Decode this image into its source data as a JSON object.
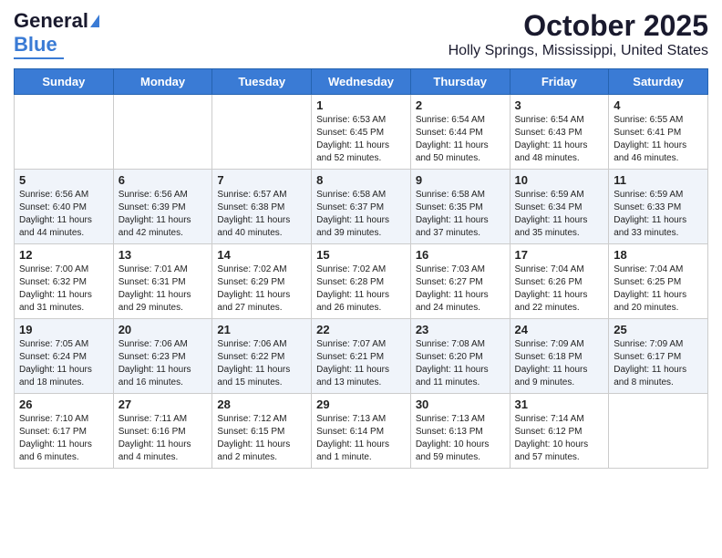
{
  "header": {
    "logo_general": "General",
    "logo_blue": "Blue",
    "title": "October 2025",
    "subtitle": "Holly Springs, Mississippi, United States"
  },
  "days_of_week": [
    "Sunday",
    "Monday",
    "Tuesday",
    "Wednesday",
    "Thursday",
    "Friday",
    "Saturday"
  ],
  "weeks": [
    [
      {
        "day": "",
        "sunrise": "",
        "sunset": "",
        "daylight": ""
      },
      {
        "day": "",
        "sunrise": "",
        "sunset": "",
        "daylight": ""
      },
      {
        "day": "",
        "sunrise": "",
        "sunset": "",
        "daylight": ""
      },
      {
        "day": "1",
        "sunrise": "Sunrise: 6:53 AM",
        "sunset": "Sunset: 6:45 PM",
        "daylight": "Daylight: 11 hours and 52 minutes."
      },
      {
        "day": "2",
        "sunrise": "Sunrise: 6:54 AM",
        "sunset": "Sunset: 6:44 PM",
        "daylight": "Daylight: 11 hours and 50 minutes."
      },
      {
        "day": "3",
        "sunrise": "Sunrise: 6:54 AM",
        "sunset": "Sunset: 6:43 PM",
        "daylight": "Daylight: 11 hours and 48 minutes."
      },
      {
        "day": "4",
        "sunrise": "Sunrise: 6:55 AM",
        "sunset": "Sunset: 6:41 PM",
        "daylight": "Daylight: 11 hours and 46 minutes."
      }
    ],
    [
      {
        "day": "5",
        "sunrise": "Sunrise: 6:56 AM",
        "sunset": "Sunset: 6:40 PM",
        "daylight": "Daylight: 11 hours and 44 minutes."
      },
      {
        "day": "6",
        "sunrise": "Sunrise: 6:56 AM",
        "sunset": "Sunset: 6:39 PM",
        "daylight": "Daylight: 11 hours and 42 minutes."
      },
      {
        "day": "7",
        "sunrise": "Sunrise: 6:57 AM",
        "sunset": "Sunset: 6:38 PM",
        "daylight": "Daylight: 11 hours and 40 minutes."
      },
      {
        "day": "8",
        "sunrise": "Sunrise: 6:58 AM",
        "sunset": "Sunset: 6:37 PM",
        "daylight": "Daylight: 11 hours and 39 minutes."
      },
      {
        "day": "9",
        "sunrise": "Sunrise: 6:58 AM",
        "sunset": "Sunset: 6:35 PM",
        "daylight": "Daylight: 11 hours and 37 minutes."
      },
      {
        "day": "10",
        "sunrise": "Sunrise: 6:59 AM",
        "sunset": "Sunset: 6:34 PM",
        "daylight": "Daylight: 11 hours and 35 minutes."
      },
      {
        "day": "11",
        "sunrise": "Sunrise: 6:59 AM",
        "sunset": "Sunset: 6:33 PM",
        "daylight": "Daylight: 11 hours and 33 minutes."
      }
    ],
    [
      {
        "day": "12",
        "sunrise": "Sunrise: 7:00 AM",
        "sunset": "Sunset: 6:32 PM",
        "daylight": "Daylight: 11 hours and 31 minutes."
      },
      {
        "day": "13",
        "sunrise": "Sunrise: 7:01 AM",
        "sunset": "Sunset: 6:31 PM",
        "daylight": "Daylight: 11 hours and 29 minutes."
      },
      {
        "day": "14",
        "sunrise": "Sunrise: 7:02 AM",
        "sunset": "Sunset: 6:29 PM",
        "daylight": "Daylight: 11 hours and 27 minutes."
      },
      {
        "day": "15",
        "sunrise": "Sunrise: 7:02 AM",
        "sunset": "Sunset: 6:28 PM",
        "daylight": "Daylight: 11 hours and 26 minutes."
      },
      {
        "day": "16",
        "sunrise": "Sunrise: 7:03 AM",
        "sunset": "Sunset: 6:27 PM",
        "daylight": "Daylight: 11 hours and 24 minutes."
      },
      {
        "day": "17",
        "sunrise": "Sunrise: 7:04 AM",
        "sunset": "Sunset: 6:26 PM",
        "daylight": "Daylight: 11 hours and 22 minutes."
      },
      {
        "day": "18",
        "sunrise": "Sunrise: 7:04 AM",
        "sunset": "Sunset: 6:25 PM",
        "daylight": "Daylight: 11 hours and 20 minutes."
      }
    ],
    [
      {
        "day": "19",
        "sunrise": "Sunrise: 7:05 AM",
        "sunset": "Sunset: 6:24 PM",
        "daylight": "Daylight: 11 hours and 18 minutes."
      },
      {
        "day": "20",
        "sunrise": "Sunrise: 7:06 AM",
        "sunset": "Sunset: 6:23 PM",
        "daylight": "Daylight: 11 hours and 16 minutes."
      },
      {
        "day": "21",
        "sunrise": "Sunrise: 7:06 AM",
        "sunset": "Sunset: 6:22 PM",
        "daylight": "Daylight: 11 hours and 15 minutes."
      },
      {
        "day": "22",
        "sunrise": "Sunrise: 7:07 AM",
        "sunset": "Sunset: 6:21 PM",
        "daylight": "Daylight: 11 hours and 13 minutes."
      },
      {
        "day": "23",
        "sunrise": "Sunrise: 7:08 AM",
        "sunset": "Sunset: 6:20 PM",
        "daylight": "Daylight: 11 hours and 11 minutes."
      },
      {
        "day": "24",
        "sunrise": "Sunrise: 7:09 AM",
        "sunset": "Sunset: 6:18 PM",
        "daylight": "Daylight: 11 hours and 9 minutes."
      },
      {
        "day": "25",
        "sunrise": "Sunrise: 7:09 AM",
        "sunset": "Sunset: 6:17 PM",
        "daylight": "Daylight: 11 hours and 8 minutes."
      }
    ],
    [
      {
        "day": "26",
        "sunrise": "Sunrise: 7:10 AM",
        "sunset": "Sunset: 6:17 PM",
        "daylight": "Daylight: 11 hours and 6 minutes."
      },
      {
        "day": "27",
        "sunrise": "Sunrise: 7:11 AM",
        "sunset": "Sunset: 6:16 PM",
        "daylight": "Daylight: 11 hours and 4 minutes."
      },
      {
        "day": "28",
        "sunrise": "Sunrise: 7:12 AM",
        "sunset": "Sunset: 6:15 PM",
        "daylight": "Daylight: 11 hours and 2 minutes."
      },
      {
        "day": "29",
        "sunrise": "Sunrise: 7:13 AM",
        "sunset": "Sunset: 6:14 PM",
        "daylight": "Daylight: 11 hours and 1 minute."
      },
      {
        "day": "30",
        "sunrise": "Sunrise: 7:13 AM",
        "sunset": "Sunset: 6:13 PM",
        "daylight": "Daylight: 10 hours and 59 minutes."
      },
      {
        "day": "31",
        "sunrise": "Sunrise: 7:14 AM",
        "sunset": "Sunset: 6:12 PM",
        "daylight": "Daylight: 10 hours and 57 minutes."
      },
      {
        "day": "",
        "sunrise": "",
        "sunset": "",
        "daylight": ""
      }
    ]
  ]
}
